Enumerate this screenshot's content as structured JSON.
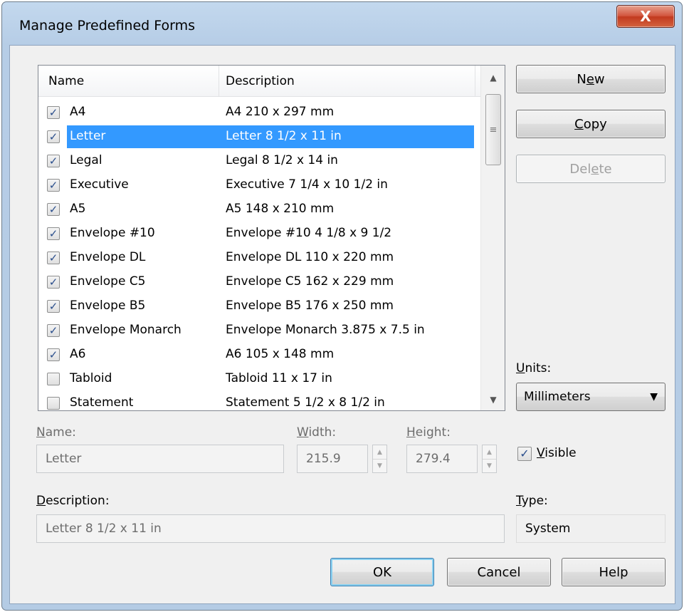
{
  "window": {
    "title": "Manage Predefined Forms",
    "close_glyph": "X"
  },
  "list": {
    "columns": {
      "name": "Name",
      "description": "Description"
    },
    "rows": [
      {
        "checked": true,
        "name": "A4",
        "description": "A4 210 x 297 mm"
      },
      {
        "checked": true,
        "name": "Letter",
        "description": "Letter 8 1/2 x 11 in",
        "selected": true
      },
      {
        "checked": true,
        "name": "Legal",
        "description": "Legal 8 1/2 x 14 in"
      },
      {
        "checked": true,
        "name": "Executive",
        "description": "Executive 7 1/4 x 10 1/2 in"
      },
      {
        "checked": true,
        "name": "A5",
        "description": "A5 148 x 210 mm"
      },
      {
        "checked": true,
        "name": "Envelope #10",
        "description": "Envelope #10 4 1/8 x 9 1/2"
      },
      {
        "checked": true,
        "name": "Envelope DL",
        "description": "Envelope DL 110 x 220 mm"
      },
      {
        "checked": true,
        "name": "Envelope C5",
        "description": "Envelope C5 162 x 229 mm"
      },
      {
        "checked": true,
        "name": "Envelope B5",
        "description": "Envelope B5  176 x 250 mm"
      },
      {
        "checked": true,
        "name": "Envelope Monarch",
        "description": "Envelope Monarch 3.875 x 7.5 in"
      },
      {
        "checked": true,
        "name": "A6",
        "description": "A6 105 x 148 mm"
      },
      {
        "checked": false,
        "name": "Tabloid",
        "description": "Tabloid 11 x 17 in"
      },
      {
        "checked": false,
        "name": "Statement",
        "description": "Statement 5 1/2 x 8 1/2 in"
      }
    ]
  },
  "buttons": {
    "new": {
      "pre": "N",
      "key": "e",
      "post": "w"
    },
    "copy": {
      "pre": "",
      "key": "C",
      "post": "opy"
    },
    "delete": {
      "pre": "Del",
      "key": "e",
      "post": "te"
    },
    "ok": "OK",
    "cancel": "Cancel",
    "help": "Help"
  },
  "units": {
    "label_key": "U",
    "label_rest": "nits:",
    "selected": "Millimeters"
  },
  "form": {
    "name_label_key": "N",
    "name_label_rest": "ame:",
    "name_value": "Letter",
    "width_label_key": "W",
    "width_label_rest": "idth:",
    "width_value": "215.9",
    "height_label_key": "H",
    "height_label_rest": "eight:",
    "height_value": "279.4",
    "visible_label_key": "V",
    "visible_label_rest": "isible",
    "visible_checked": true,
    "description_label_key": "D",
    "description_label_rest": "escription:",
    "description_value": "Letter 8 1/2 x 11 in",
    "type_label_key": "T",
    "type_label_rest": "ype:",
    "type_value": "System"
  },
  "colors": {
    "selection": "#3399ff",
    "title_gradient": "#c3d8ee",
    "client_bg": "#f0f0f0"
  },
  "icons": {
    "close": "close-icon",
    "check": "checkmark-icon",
    "scroll_up": "scroll-up-arrow-icon",
    "scroll_down": "scroll-down-arrow-icon",
    "dropdown": "dropdown-arrow-icon"
  }
}
